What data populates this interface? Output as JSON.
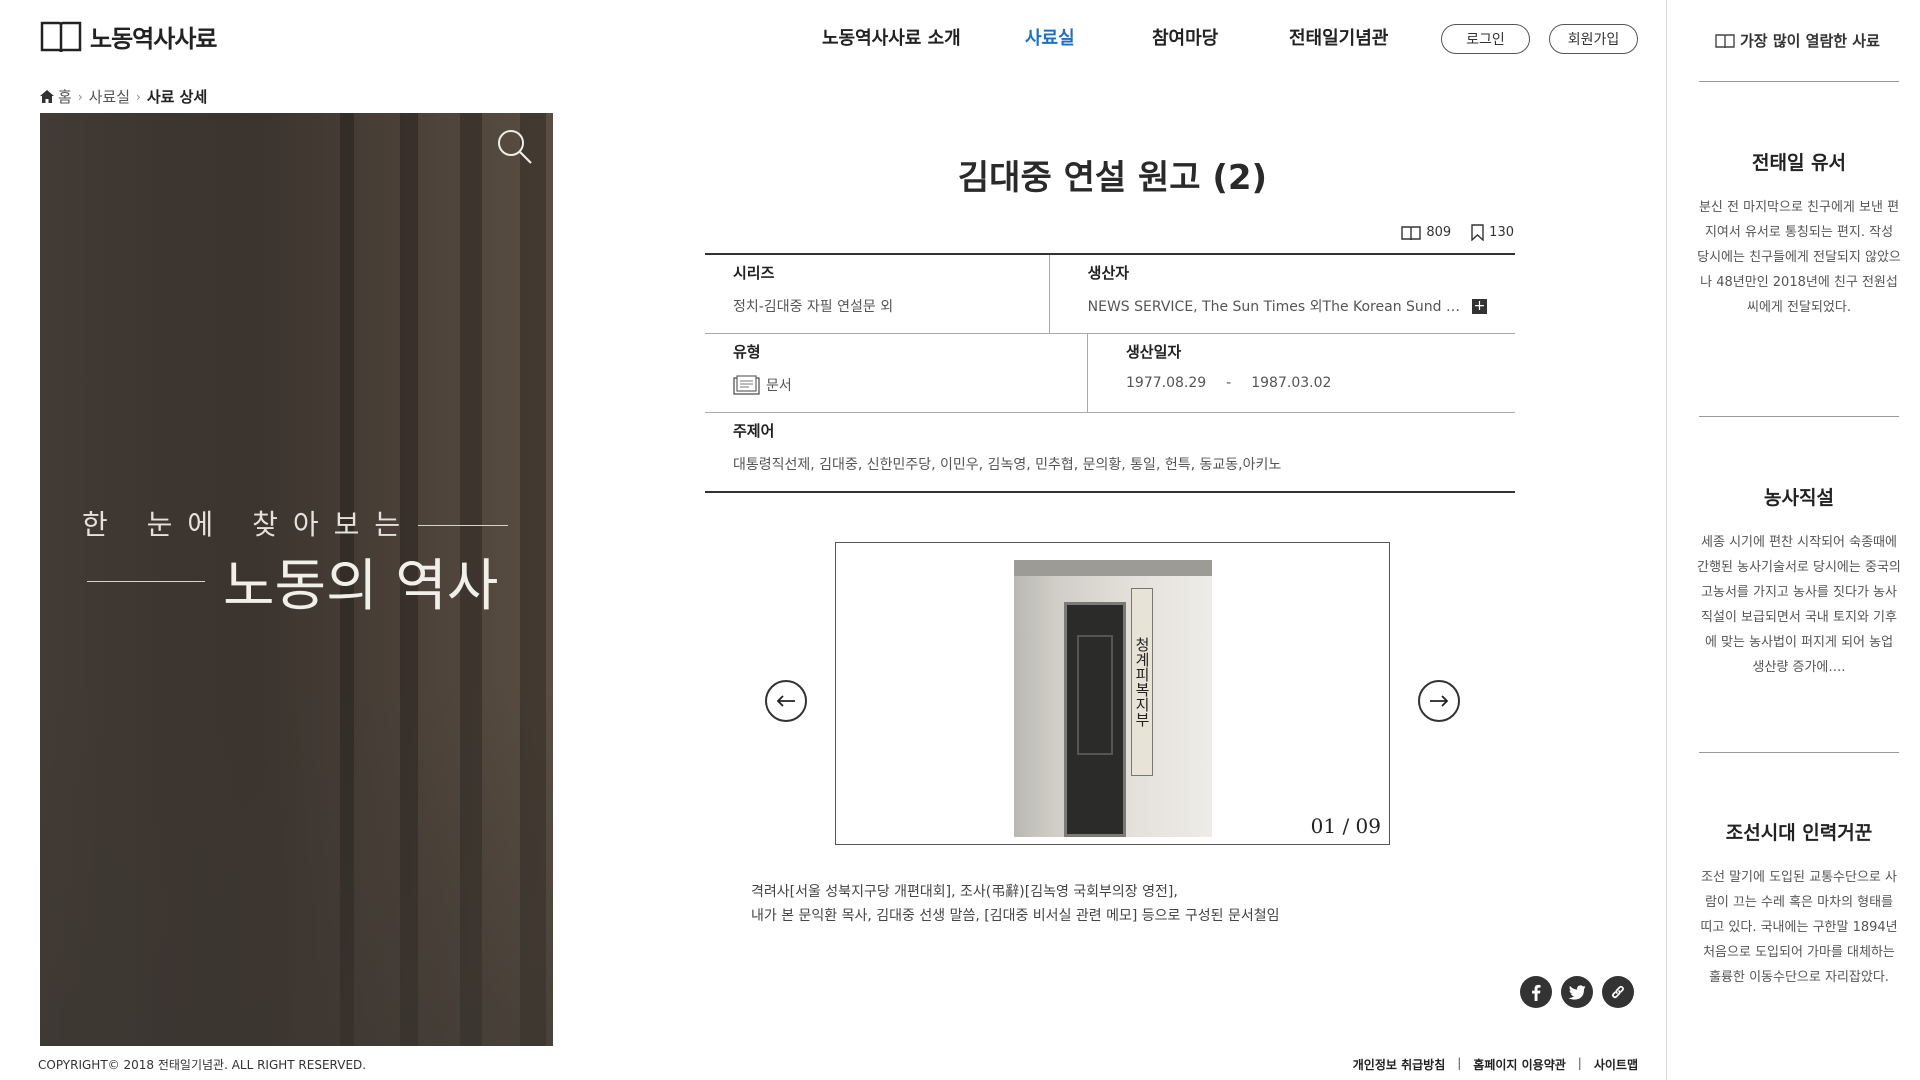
{
  "header": {
    "logo_text": "노동역사사료",
    "nav": [
      "노동역사사료 소개",
      "사료실",
      "참여마당",
      "전태일기념관"
    ],
    "nav_active": "사료실",
    "login": "로그인",
    "signup": "회원가입"
  },
  "breadcrumb": {
    "home": "홈",
    "section": "사료실",
    "current": "사료 상세"
  },
  "hero": {
    "subtitle": "한  눈에  찾아보는",
    "title": "노동의 역사"
  },
  "detail": {
    "title": "김대중 연설 원고 (2)",
    "views": "809",
    "bookmarks": "130",
    "series_label": "시리즈",
    "series_value": "정치-김대중 자필 연설문 외",
    "producer_label": "생산자",
    "producer_value": "NEWS SERVICE, The Sun Times 외The Korean Sund …",
    "type_label": "유형",
    "type_value": "문서",
    "date_label": "생산일자",
    "date_start": "1977.08.29",
    "date_sep": "-",
    "date_end": "1987.03.02",
    "keyword_label": "주제어",
    "keyword_value": "대통령직선제, 김대중, 신한민주당, 이민우, 김녹영, 민추협, 문의황, 통일, 헌특, 동교동,아키노"
  },
  "viewer": {
    "counter": "01 / 09",
    "sign_text": "청계피복지부",
    "description_line1": "격려사[서울 성북지구당 개편대회], 조사(弔辭)[김녹영 국회부의장 영전],",
    "description_line2": "내가 본 문익환 목사,  김대중 선생 말씀, [김대중 비서실 관련 메모] 등으로 구성된 문서철임"
  },
  "share": {
    "icons": [
      "facebook-icon",
      "twitter-icon",
      "link-icon"
    ]
  },
  "footer": {
    "copyright": "COPYRIGHT©  2018 전태일기념관.  ALL RIGHT RESERVED.",
    "links": [
      "개인정보 취급방침",
      "홈페이지 이용약관",
      "사이트맵"
    ]
  },
  "sidebar": {
    "heading": "가장 많이 열람한 사료",
    "items": [
      {
        "title": "전태일 유서",
        "text": "분신 전 마지막으로 친구에게 보낸 편지여서 유서로 통칭되는 편지. 작성 당시에는 친구들에게 전달되지 않았으나 48년만인 2018년에 친구 전원섭씨에게 전달되었다."
      },
      {
        "title": "농사직설",
        "text": "세종 시기에 편찬 시작되어 숙종때에 간행된 농사기술서로 당시에는 중국의 고농서를 가지고 농사를 짓다가 농사직설이 보급되면서 국내 토지와 기후에 맞는 농사법이 퍼지게 되어 농업 생산량 증가에…."
      },
      {
        "title": "조선시대 인력거꾼",
        "text": "조선 말기에 도입된 교통수단으로 사람이 끄는 수레 혹은 마차의 형태를 띠고 있다. 국내에는 구한말 1894년 처음으로 도입되어 가마를 대체하는 훌륭한 이동수단으로 자리잡았다."
      }
    ]
  },
  "colors": {
    "accent": "#1f6fbf",
    "text": "#222222",
    "hero_dark": "#2e2925"
  }
}
